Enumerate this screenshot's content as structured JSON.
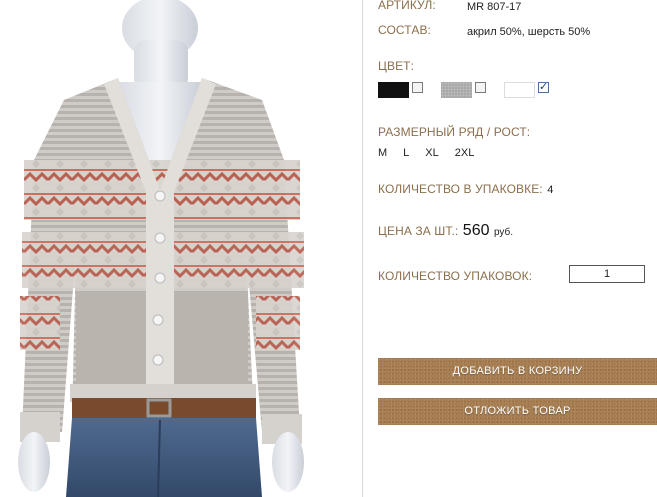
{
  "product": {
    "article_label": "АРТИКУЛ:",
    "article_value": "MR 807-17",
    "composition_label": "СОСТАВ:",
    "composition_value": "акрил 50%, шерсть 50%",
    "color_label": "ЦВЕТ:",
    "colors": [
      {
        "name": "black",
        "hex": "#111111",
        "checked": false
      },
      {
        "name": "gray",
        "hex": "#a8a8a8",
        "checked": false
      },
      {
        "name": "white",
        "hex": "#ffffff",
        "checked": true
      }
    ],
    "size_label": "РАЗМЕРНЫЙ РЯД / РОСТ:",
    "sizes": [
      "M",
      "L",
      "XL",
      "2XL"
    ],
    "pack_qty_label": "КОЛИЧЕСТВО В УПАКОВКЕ:",
    "pack_qty_value": "4",
    "price_label": "ЦЕНА ЗА ШТ.:",
    "price_value": "560",
    "price_currency": "руб.",
    "packs_label": "КОЛИЧЕСТВО УПАКОВОК:",
    "packs_value": "1"
  },
  "actions": {
    "add_to_cart": "ДОБАВИТЬ В КОРЗИНУ",
    "postpone": "ОТЛОЖИТЬ ТОВАР"
  },
  "colors_ui": {
    "label": "#8a6f4d",
    "button": "#a67c4e"
  }
}
